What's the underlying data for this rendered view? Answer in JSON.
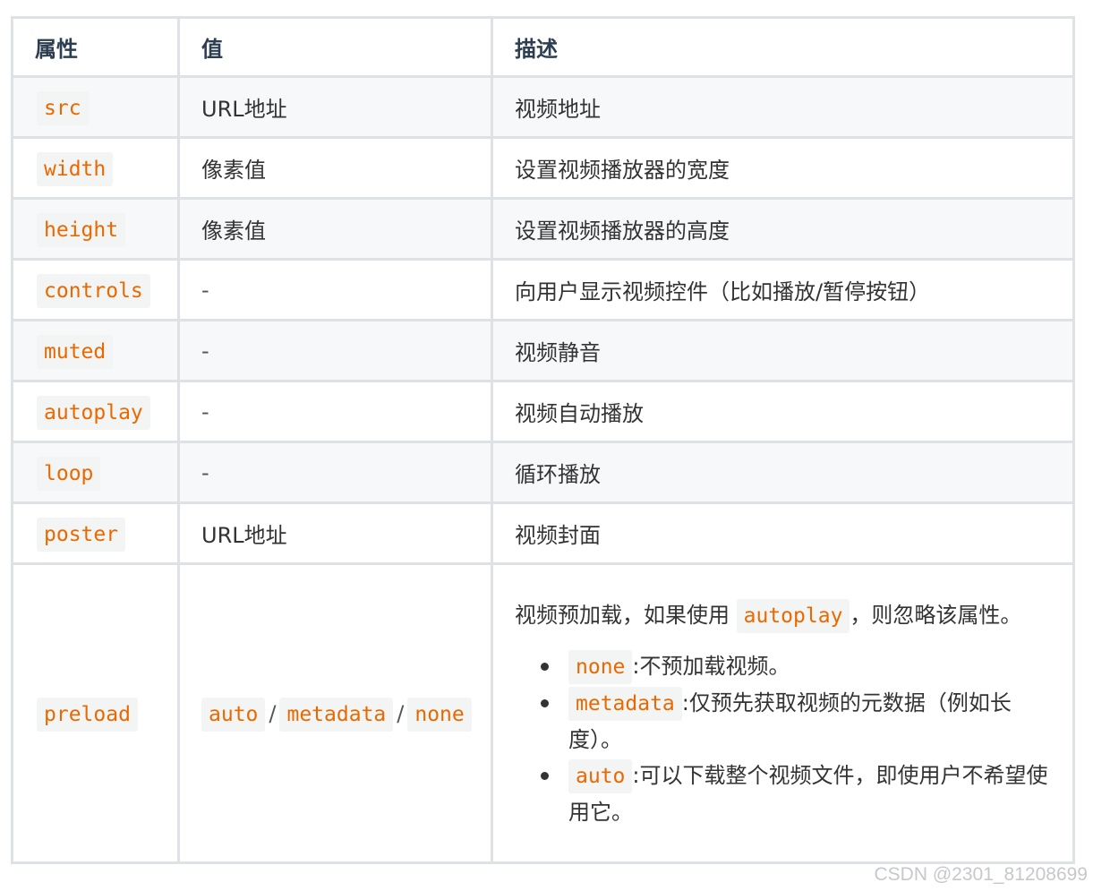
{
  "table": {
    "headers": [
      "属性",
      "值",
      "描述"
    ],
    "rows": [
      {
        "attr": "src",
        "value": "URL地址",
        "desc": "视频地址"
      },
      {
        "attr": "width",
        "value": "像素值",
        "desc": "设置视频播放器的宽度"
      },
      {
        "attr": "height",
        "value": "像素值",
        "desc": "设置视频播放器的高度"
      },
      {
        "attr": "controls",
        "value": "-",
        "desc": "向用户显示视频控件（比如播放/暂停按钮）"
      },
      {
        "attr": "muted",
        "value": "-",
        "desc": "视频静音"
      },
      {
        "attr": "autoplay",
        "value": "-",
        "desc": "视频自动播放"
      },
      {
        "attr": "loop",
        "value": "-",
        "desc": "循环播放"
      },
      {
        "attr": "poster",
        "value": "URL地址",
        "desc": "视频封面"
      }
    ],
    "preload": {
      "attr": "preload",
      "values": [
        "auto",
        "metadata",
        "none"
      ],
      "separator": "/",
      "desc_prefix": "视频预加载，如果使用",
      "desc_code": "autoplay",
      "desc_suffix": "，则忽略该属性。",
      "options": [
        {
          "code": "none",
          "text": ":不预加载视频。"
        },
        {
          "code": "metadata",
          "text": ":仅预先获取视频的元数据（例如长度）。"
        },
        {
          "code": "auto",
          "text": ":可以下载整个视频文件，即使用户不希望使用它。"
        }
      ]
    }
  },
  "watermark": "CSDN @2301_81208699"
}
